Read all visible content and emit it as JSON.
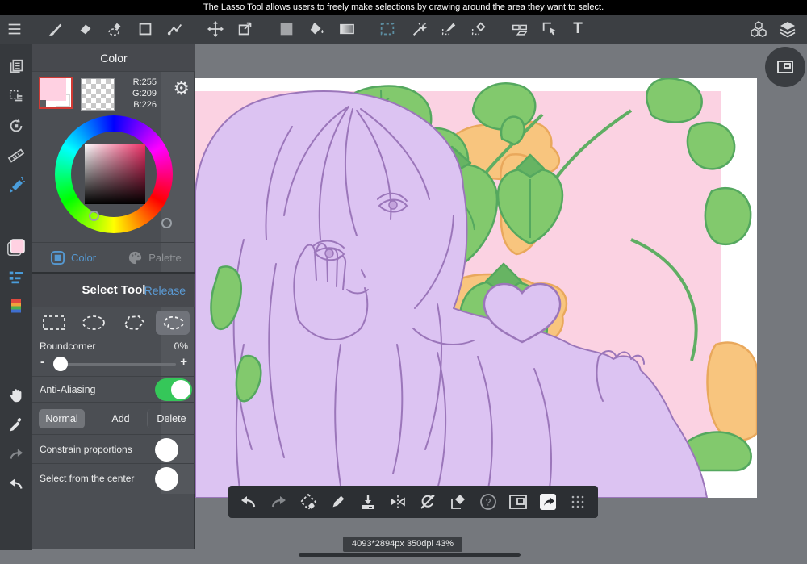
{
  "tooltip_bar": {
    "text": "The Lasso Tool allows users to freely make selections by drawing around the area they want to select."
  },
  "top_toolbar": {
    "text_tool_glyph": "T"
  },
  "color_panel": {
    "title": "Color",
    "rgb": {
      "r": "R:255",
      "g": "G:209",
      "b": "B:226"
    },
    "foreground_color": "#FFD1E2",
    "tabs": {
      "color": "Color",
      "palette": "Palette"
    }
  },
  "select_tool_panel": {
    "title": "Select Tool",
    "release_link": "Release",
    "roundcorner_label": "Roundcorner",
    "roundcorner_value": "0%",
    "slider_minus": "-",
    "slider_plus": "+",
    "anti_aliasing_label": "Anti-Aliasing",
    "anti_aliasing_on": true,
    "modes": [
      "Normal",
      "Add",
      "Delete"
    ],
    "active_mode": "Normal",
    "constrain_label": "Constrain proportions",
    "center_label": "Select from the center"
  },
  "bottom_toolbar": {
    "help_glyph": "?"
  },
  "status_bar": {
    "canvas_info": "4093*2894px 350dpi 43%"
  },
  "colors": {
    "selected_color_hex": "#FFD1E2",
    "toggle_on_green": "#35C759",
    "accent_blue": "#5598D0",
    "canvas_pink": "#FBD2E2",
    "art_purple_fill": "#DCC3F2",
    "art_purple_line": "#9B76BA",
    "art_green_fill": "#82C96D",
    "art_green_line": "#55A85F",
    "art_orange_fill": "#F8C57E",
    "art_orange_line": "#E9A85C"
  },
  "icons": {
    "top_toolbar": [
      "menu-icon",
      "brush-icon",
      "eraser-icon",
      "lasso-eraser-icon",
      "rect-tool-icon",
      "polyline-icon",
      "move-icon",
      "transform-icon",
      "fill-rect-icon",
      "bucket-icon",
      "gradient-icon",
      "marquee-select-icon",
      "magic-wand-icon",
      "select-pen-icon",
      "select-eraser-icon",
      "divide-frame-icon",
      "object-select-icon",
      "text-tool-icon",
      "material-icon",
      "layers-icon"
    ],
    "left_sidebar": [
      "pages-icon",
      "select-layout-icon",
      "rotate-view-icon",
      "ruler-icon",
      "airbrush-icon",
      "foreground-color-swatch",
      "brush-settings-icon",
      "color-set-icon",
      "hand-icon",
      "eyedropper-icon",
      "redo-icon",
      "undo-icon"
    ],
    "bottom_toolbar": [
      "undo-icon",
      "redo-icon",
      "transform-selection-icon",
      "pen-icon",
      "save-icon",
      "flip-horizontal-icon",
      "rotate-reset-icon",
      "clear-selection-icon",
      "help-icon",
      "floating-window-icon",
      "share-icon",
      "drag-handle-icon"
    ]
  }
}
